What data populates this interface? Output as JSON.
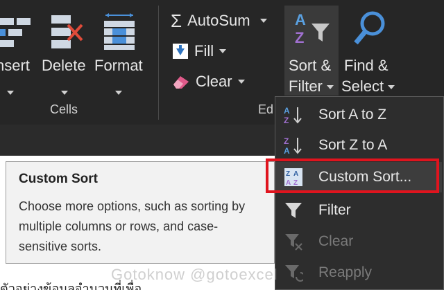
{
  "ribbon": {
    "insert_label": "nsert",
    "delete_label": "Delete",
    "format_label": "Format",
    "cells_group_label": "Cells",
    "editing_group_label": "Ed",
    "autosum_label": "AutoSum",
    "fill_label": "Fill",
    "clear_label": "Clear",
    "sort_filter_line1": "Sort &",
    "sort_filter_line2": "Filter",
    "find_select_line1": "Find &",
    "find_select_line2": "Select"
  },
  "menu": {
    "items": [
      {
        "label": "Sort A to Z",
        "icon": "sort-a-to-z-icon",
        "disabled": false
      },
      {
        "label": "Sort Z to A",
        "icon": "sort-z-to-a-icon",
        "disabled": false
      },
      {
        "label": "Custom Sort...",
        "icon": "custom-sort-icon",
        "disabled": false
      },
      {
        "label": "Filter",
        "icon": "filter-icon",
        "disabled": false
      },
      {
        "label": "Clear",
        "icon": "clear-filter-icon",
        "disabled": true
      },
      {
        "label": "Reapply",
        "icon": "reapply-icon",
        "disabled": true
      }
    ]
  },
  "tooltip": {
    "title": "Custom Sort",
    "description": "Choose more options, such as sorting by multiple columns or rows, and case-sensitive sorts."
  },
  "watermark": "Gotoknow @gotoexcel",
  "sheet_text": "ตัวอย่างข้อมูลจำนวนที่เพื่อ",
  "colors": {
    "highlight_border": "#e0141e",
    "menu_bg": "#2d2d2d",
    "ribbon_bg": "#262626"
  }
}
